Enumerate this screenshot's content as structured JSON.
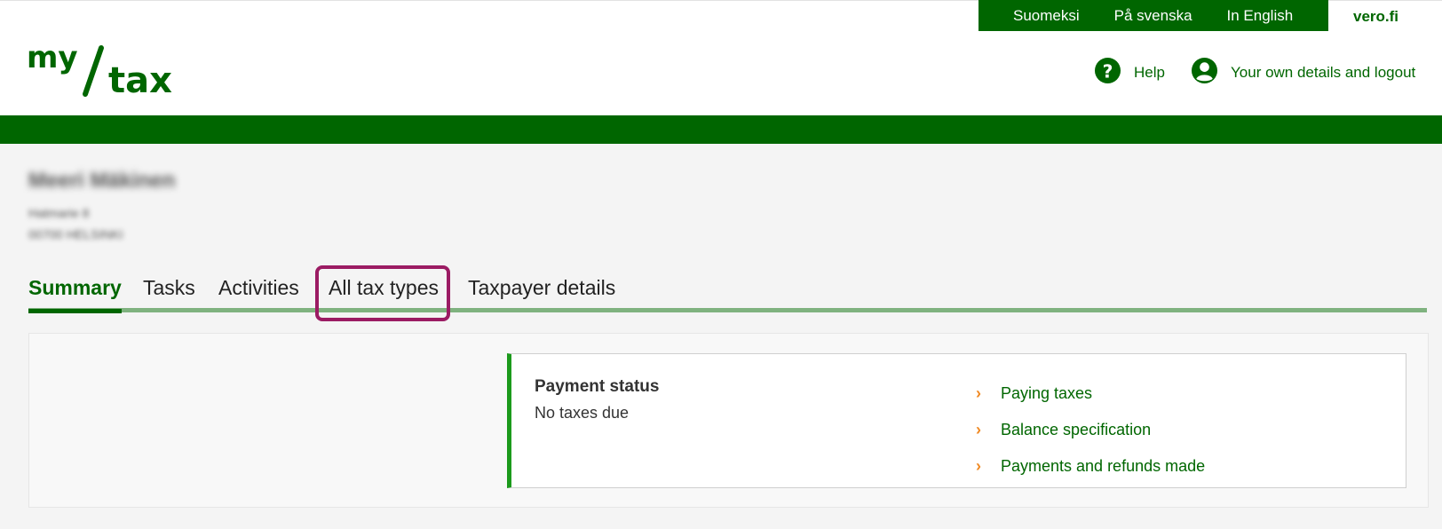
{
  "languages": [
    "Suomeksi",
    "På svenska",
    "In English"
  ],
  "site_link": "vero.fi",
  "logo": {
    "text_top": "my",
    "text_bottom": "tax"
  },
  "header_actions": {
    "help": "Help",
    "account": "Your own details and logout"
  },
  "user": {
    "name": "Meeri Mäkinen",
    "address_line1": "Hatmarie 8",
    "address_line2": "00700 HELSINKI"
  },
  "tabs": [
    "Summary",
    "Tasks",
    "Activities",
    "All tax types",
    "Taxpayer details"
  ],
  "active_tab": "Summary",
  "payment_card": {
    "title": "Payment status",
    "status": "No taxes due",
    "links": [
      "Paying taxes",
      "Balance specification",
      "Payments and refunds made"
    ]
  },
  "colors": {
    "brand_green": "#006600",
    "highlight": "#9b1b63",
    "chevron": "#f08a24",
    "card_accent": "#1c9a1c"
  },
  "icons": [
    "question-circle-icon",
    "user-circle-icon",
    "chevron-right-icon"
  ]
}
